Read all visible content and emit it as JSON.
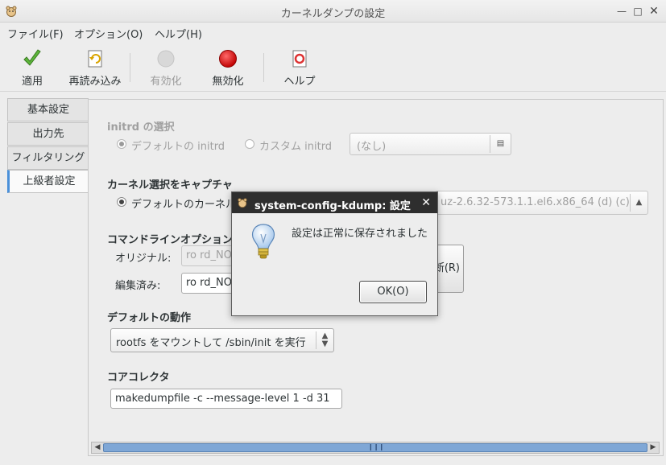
{
  "window": {
    "title": "カーネルダンプの設定"
  },
  "menu": [
    "ファイル(F)",
    "オプション(O)",
    "ヘルプ(H)"
  ],
  "toolbar": {
    "apply": "適用",
    "reload": "再読み込み",
    "enable": "有効化",
    "disable": "無効化",
    "help": "ヘルプ"
  },
  "tabs": [
    "基本設定",
    "出力先",
    "フィルタリング",
    "上級者設定"
  ],
  "initrd": {
    "title": "initrd の選択",
    "default_label": "デフォルトの initrd",
    "custom_label": "カスタム initrd",
    "path_value": "(なし)"
  },
  "kernel": {
    "title": "カーネル選択をキャプチャ",
    "default_label": "デフォルトのカーネル",
    "combo_value": "uz-2.6.32-573.1.1.el6.x86_64 (d) (c)"
  },
  "cmdline": {
    "title": "コマンドラインオプション",
    "original_label": "オリジナル:",
    "original_value": "ro rd_NO",
    "edited_label": "編集済み:",
    "edited_value": "ro rd_NO",
    "reset_label": "断(R)"
  },
  "default_action": {
    "title": "デフォルトの動作",
    "value": "rootfs をマウントして /sbin/init を実行"
  },
  "core_collector": {
    "title": "コアコレクタ",
    "value": "makedumpfile -c --message-level 1 -d 31"
  },
  "dialog": {
    "title": "system-config-kdump: 設定",
    "message": "設定は正常に保存されました",
    "ok": "OK(O)"
  },
  "colors": {
    "accent": "#4a90d9",
    "scroll_thumb": "#7fa7d6",
    "dialog_title_bg": "#2e2e2e"
  }
}
